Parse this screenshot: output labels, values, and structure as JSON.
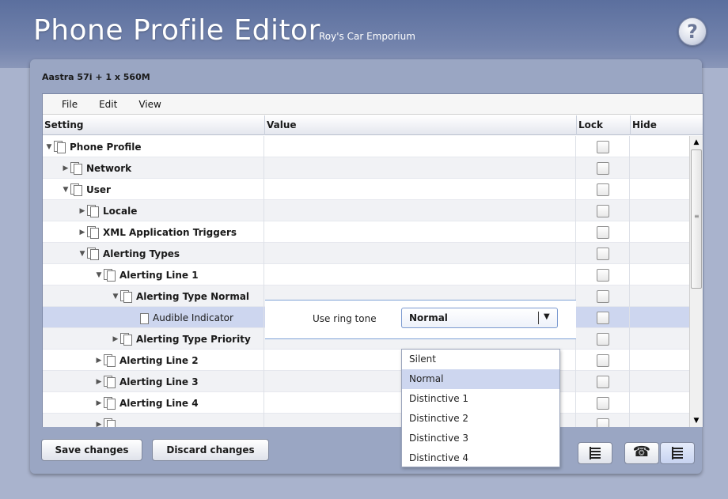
{
  "header": {
    "title": "Phone Profile Editor",
    "subtitle": "Roy's Car Emporium",
    "help_label": "?"
  },
  "device": {
    "label": "Aastra 57i + 1 x 560M"
  },
  "menu": {
    "items": [
      "File",
      "Edit",
      "View"
    ]
  },
  "columns": {
    "setting": "Setting",
    "value": "Value",
    "lock": "Lock",
    "hide": "Hide"
  },
  "tree": [
    {
      "label": "Phone Profile",
      "depth": 0,
      "state": "expanded"
    },
    {
      "label": "Network",
      "depth": 1,
      "state": "collapsed"
    },
    {
      "label": "User",
      "depth": 1,
      "state": "expanded"
    },
    {
      "label": "Locale",
      "depth": 2,
      "state": "collapsed"
    },
    {
      "label": "XML Application Triggers",
      "depth": 2,
      "state": "collapsed"
    },
    {
      "label": "Alerting Types",
      "depth": 2,
      "state": "expanded"
    },
    {
      "label": "Alerting Line 1",
      "depth": 3,
      "state": "expanded"
    },
    {
      "label": "Alerting Type Normal",
      "depth": 4,
      "state": "expanded"
    },
    {
      "label": "Audible Indicator",
      "depth": 5,
      "state": "leaf",
      "selected": true
    },
    {
      "label": "Alerting Type Priority",
      "depth": 4,
      "state": "collapsed"
    },
    {
      "label": "Alerting Line 2",
      "depth": 3,
      "state": "collapsed"
    },
    {
      "label": "Alerting Line 3",
      "depth": 3,
      "state": "collapsed"
    },
    {
      "label": "Alerting Line 4",
      "depth": 3,
      "state": "collapsed"
    },
    {
      "label": "",
      "depth": 3,
      "state": "collapsed"
    }
  ],
  "value_editor": {
    "label": "Use ring tone",
    "selected": "Normal",
    "options": [
      "Silent",
      "Normal",
      "Distinctive 1",
      "Distinctive 2",
      "Distinctive 3",
      "Distinctive 4"
    ]
  },
  "buttons": {
    "save": "Save changes",
    "discard": "Discard changes"
  },
  "icons": {
    "help": "help-icon",
    "expanded": "triangle-down-icon",
    "collapsed": "triangle-right-icon",
    "document": "document-icon",
    "list_view": "list-view-icon",
    "phone_view": "phone-icon"
  },
  "colors": {
    "header": "#5b6f9e",
    "panel": "#9aa6c3",
    "selection": "#cdd6ef",
    "accent": "#7fa2d6"
  }
}
